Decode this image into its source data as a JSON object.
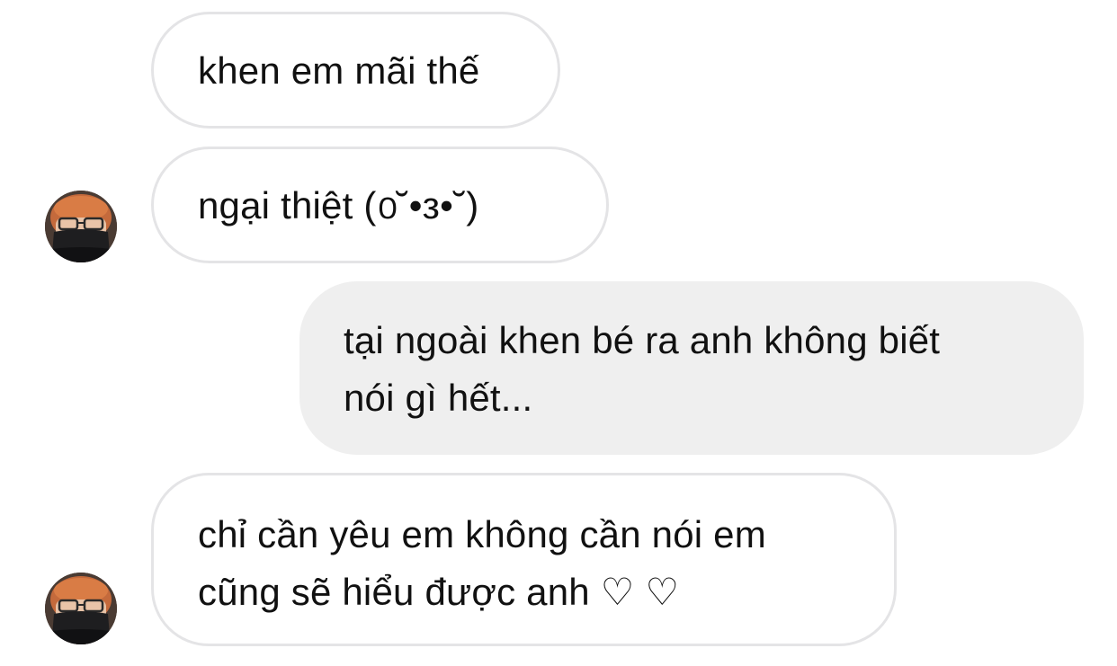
{
  "thread": {
    "messages": [
      {
        "sender": "other",
        "text": "khen em mãi thế"
      },
      {
        "sender": "other",
        "text": "ngại thiệt (൦˘•з•˘)"
      },
      {
        "sender": "me",
        "text": "tại ngoài khen bé ra anh không biết\nnói gì hết..."
      },
      {
        "sender": "other",
        "text": "chỉ cần yêu em không cần nói em\ncũng sẽ hiểu được anh ♡ ♡"
      }
    ]
  },
  "colors": {
    "incoming_bubble_bg": "#ffffff",
    "incoming_bubble_border": "#e4e4e6",
    "outgoing_bubble_bg": "#efefef",
    "text": "#111111"
  },
  "avatars": [
    {
      "icon": "profile-avatar",
      "description_icon": "person-with-mask-and-glasses"
    },
    {
      "icon": "profile-avatar",
      "description_icon": "person-with-mask-and-glasses"
    }
  ]
}
